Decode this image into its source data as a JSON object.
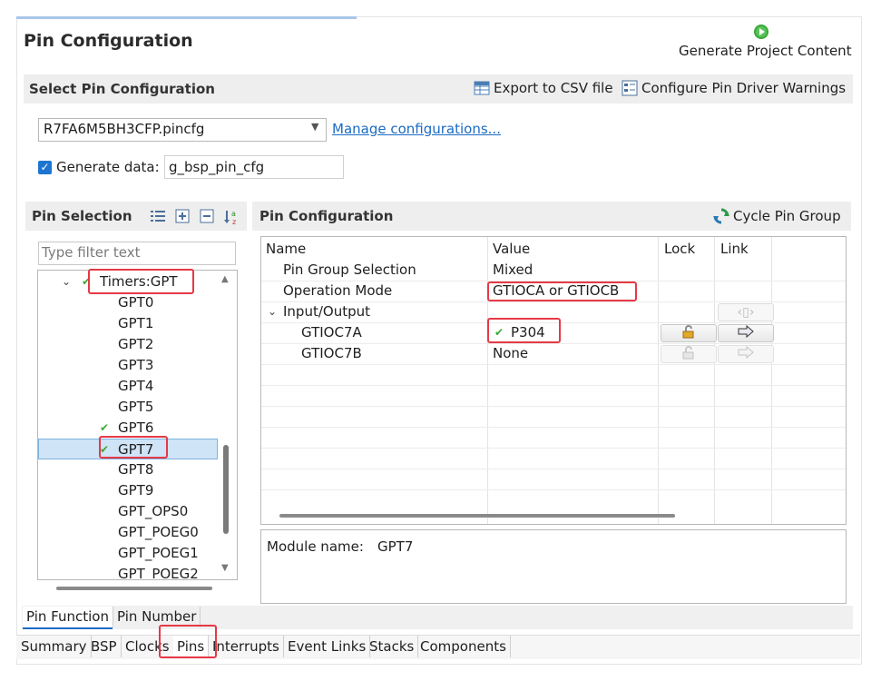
{
  "header": {
    "title": "Pin Configuration",
    "generate_label": "Generate Project Content"
  },
  "select_pin_config": {
    "section_title": "Select Pin Configuration",
    "export_csv": "Export to CSV file",
    "configure_warnings": "Configure Pin Driver Warnings",
    "config_file": "R7FA6M5BH3CFP.pincfg",
    "manage_link": "Manage configurations...",
    "generate_data_label": "Generate data:",
    "generate_data_checked": true,
    "generate_data_value": "g_bsp_pin_cfg"
  },
  "pin_selection": {
    "title": "Pin Selection",
    "filter_placeholder": "Type filter text",
    "group": "Timers:GPT",
    "items": [
      "GPT0",
      "GPT1",
      "GPT2",
      "GPT3",
      "GPT4",
      "GPT5",
      "GPT6",
      "GPT7",
      "GPT8",
      "GPT9",
      "GPT_OPS0",
      "GPT_POEG0",
      "GPT_POEG1",
      "GPT_POEG2"
    ],
    "checked_items": [
      "GPT6",
      "GPT7"
    ],
    "selected_item": "GPT7"
  },
  "pin_configuration": {
    "title": "Pin Configuration",
    "cycle_label": "Cycle Pin Group",
    "columns": [
      "Name",
      "Value",
      "Lock",
      "Link"
    ],
    "rows": [
      {
        "name": "Pin Group Selection",
        "value": "Mixed"
      },
      {
        "name": "Operation Mode",
        "value": "GTIOCA or GTIOCB"
      },
      {
        "name": "Input/Output",
        "value": ""
      },
      {
        "name": "GTIOC7A",
        "value": "P304"
      },
      {
        "name": "GTIOC7B",
        "value": "None"
      }
    ],
    "module_label": "Module name:",
    "module_value": "GPT7"
  },
  "pin_tabs": [
    "Pin Function",
    "Pin Number"
  ],
  "editor_tabs": [
    "Summary",
    "BSP",
    "Clocks",
    "Pins",
    "Interrupts",
    "Event Links",
    "Stacks",
    "Components"
  ],
  "colors": {
    "accent": "#1a6bc4",
    "highlight": "#e63946",
    "check": "#3aa83a"
  }
}
